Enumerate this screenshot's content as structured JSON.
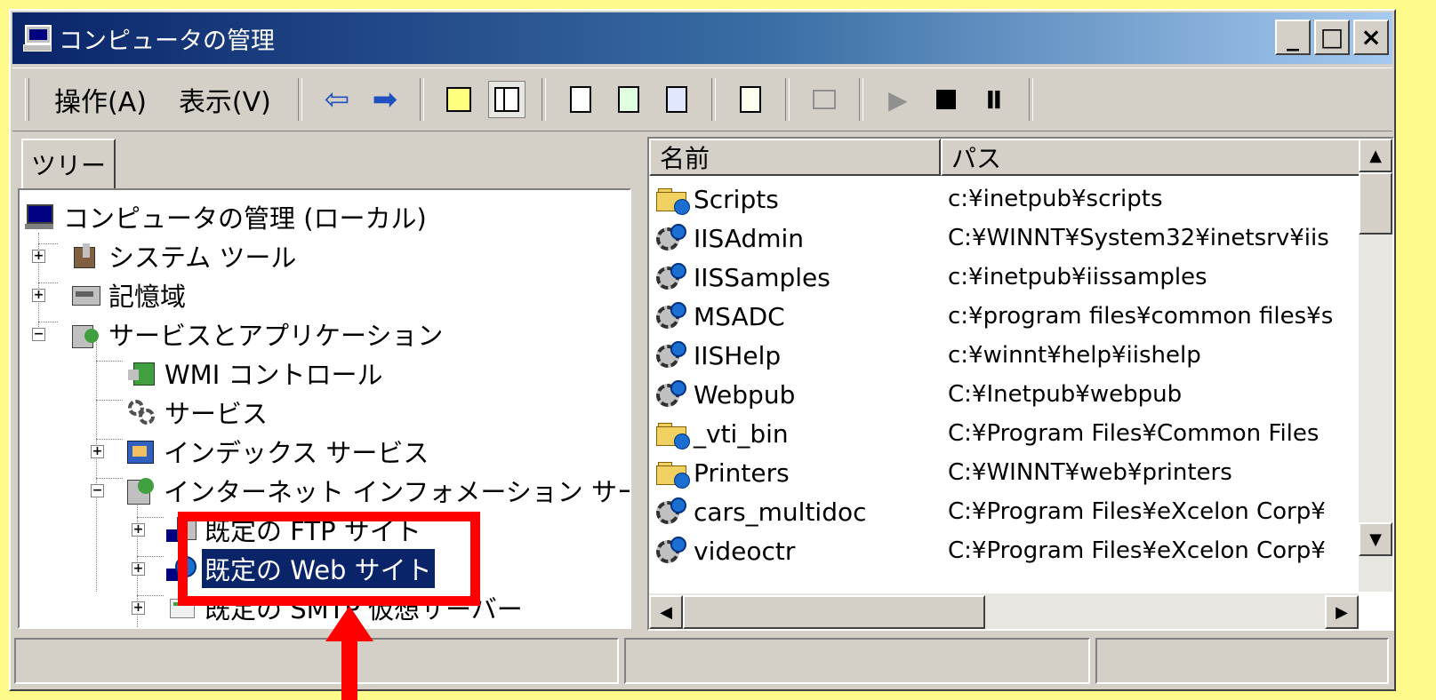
{
  "window": {
    "title": "コンピュータの管理",
    "controls": {
      "minimize": "_",
      "maximize": "□",
      "close": "×"
    }
  },
  "toolbar": {
    "menus": [
      "操作(A)",
      "表示(V)"
    ],
    "icons": [
      "back-arrow-icon",
      "forward-arrow-icon",
      "up-folder-icon",
      "show-tree-icon",
      "properties-icon",
      "refresh-icon",
      "export-list-icon",
      "help-icon",
      "computer-icon",
      "start-icon",
      "stop-icon",
      "pause-icon"
    ],
    "glyphs": {
      "back": "⇦",
      "forward": "➡",
      "start": "▶",
      "pause": "Ⅱ"
    }
  },
  "tree": {
    "tab_label": "ツリー",
    "nodes": [
      {
        "label": "コンピュータの管理 (ローカル)",
        "icon": "computer-icon",
        "expander": ""
      },
      {
        "label": "システム ツール",
        "icon": "tools-icon",
        "expander": "+"
      },
      {
        "label": "記憶域",
        "icon": "storage-icon",
        "expander": "+"
      },
      {
        "label": "サービスとアプリケーション",
        "icon": "services-apps-icon",
        "expander": "−"
      },
      {
        "label": "WMI コントロール",
        "icon": "wmi-icon",
        "expander": ""
      },
      {
        "label": "サービス",
        "icon": "gears-icon",
        "expander": ""
      },
      {
        "label": "インデックス サービス",
        "icon": "index-service-icon",
        "expander": "+"
      },
      {
        "label": "インターネット インフォメーション サービス",
        "icon": "iis-icon",
        "expander": "−"
      },
      {
        "label": "既定の FTP サイト",
        "icon": "ftp-site-icon",
        "expander": "+"
      },
      {
        "label": "既定の Web サイト",
        "icon": "web-site-icon",
        "expander": "+",
        "selected": true
      },
      {
        "label": "既定の SMTP 仮想サーバー",
        "icon": "smtp-server-icon",
        "expander": "+"
      }
    ]
  },
  "list": {
    "columns": [
      "名前",
      "パス"
    ],
    "rows": [
      {
        "name": "Scripts",
        "path": "c:¥inetpub¥scripts",
        "icon": "folder-globe-icon"
      },
      {
        "name": "IISAdmin",
        "path": "C:¥WINNT¥System32¥inetsrv¥iis",
        "icon": "virtual-directory-icon"
      },
      {
        "name": "IISSamples",
        "path": "c:¥inetpub¥iissamples",
        "icon": "virtual-directory-icon"
      },
      {
        "name": "MSADC",
        "path": "c:¥program files¥common files¥s",
        "icon": "virtual-directory-icon"
      },
      {
        "name": "IISHelp",
        "path": "c:¥winnt¥help¥iishelp",
        "icon": "virtual-directory-icon"
      },
      {
        "name": "Webpub",
        "path": "C:¥Inetpub¥webpub",
        "icon": "virtual-directory-icon"
      },
      {
        "name": "_vti_bin",
        "path": "C:¥Program Files¥Common Files",
        "icon": "folder-globe-icon"
      },
      {
        "name": "Printers",
        "path": "C:¥WINNT¥web¥printers",
        "icon": "folder-globe-icon"
      },
      {
        "name": "cars_multidoc",
        "path": "C:¥Program Files¥eXcelon Corp¥",
        "icon": "virtual-directory-icon"
      },
      {
        "name": "videoctr",
        "path": "C:¥Program Files¥eXcelon Corp¥",
        "icon": "virtual-directory-icon"
      }
    ]
  },
  "scroll_glyphs": {
    "up": "▲",
    "down": "▼",
    "left": "◀",
    "right": "▶"
  },
  "colors": {
    "background": "#fffb8a",
    "titlebar_start": "#0a246a",
    "selection": "#0a246a",
    "annotation": "#ff0000"
  }
}
